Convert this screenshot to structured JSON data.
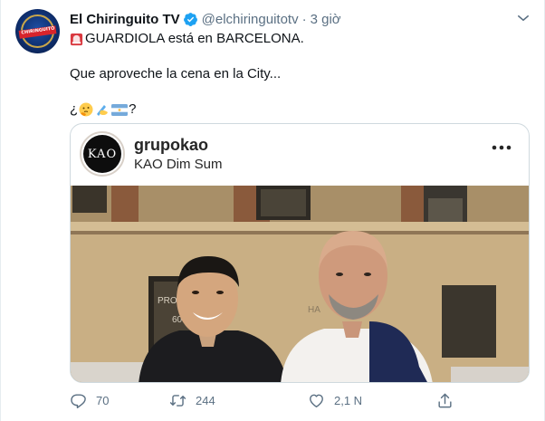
{
  "tweet": {
    "display_name": "El Chiringuito TV",
    "handle": "@elchiringuitotv",
    "separator": "·",
    "time": "3 giờ",
    "avatar_text": "CHIRINGUITO",
    "line1": "GUARDIOLA está en BARCELONA.",
    "line2": "Que aproveche la cena en la City...",
    "line3_open": "¿",
    "line3_close": "?",
    "icons": {
      "siren": "rotating-light-icon",
      "thinking": "thinking-face-icon",
      "writing": "writing-hand-icon",
      "flag": "argentina-flag-icon",
      "verified": "verified-badge-icon",
      "caret": "chevron-down-icon"
    }
  },
  "card": {
    "logo_text": "KAO",
    "username": "grupokao",
    "subtitle": "KAO  Dim Sum",
    "photo_sign_1": "PROPE",
    "photo_sign_2": "60849",
    "photo_sign_3": "HA"
  },
  "actions": {
    "reply_count": "70",
    "retweet_count": "244",
    "like_count": "2,1 N",
    "share_label": ""
  },
  "colors": {
    "accent": "#1da1f2",
    "text_primary": "#0f1419",
    "text_secondary": "#5b7083",
    "border": "#cfd9de"
  }
}
